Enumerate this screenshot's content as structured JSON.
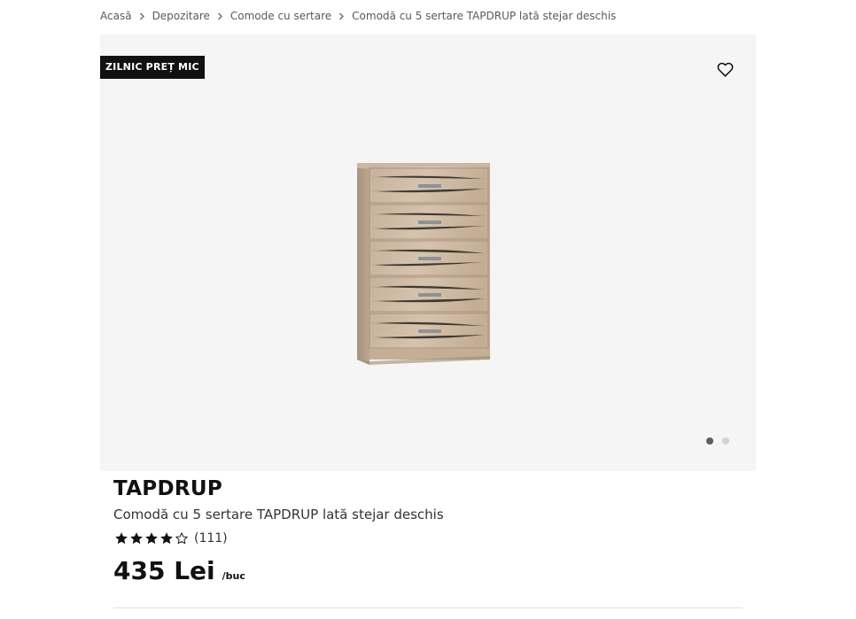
{
  "breadcrumb": {
    "items": [
      "Acasă",
      "Depozitare",
      "Comode cu sertare",
      "Comodă cu 5 sertare TAPDRUP lată stejar deschis"
    ]
  },
  "gallery": {
    "badge": "ZILNIC PREȚ MIC",
    "wishlist_icon": "heart-outline-icon",
    "image_count": 2,
    "active_image": 1
  },
  "product": {
    "brand": "TAPDRUP",
    "name": "Comodă cu 5 sertare TAPDRUP lată stejar deschis",
    "rating": {
      "stars": 4,
      "max_stars": 5,
      "count": "(111)"
    },
    "price": {
      "value": "435 Lei",
      "unit": "/buc"
    }
  },
  "colors": {
    "badge_bg": "#111111",
    "gallery_bg": "#f5f5f5",
    "dot_active": "#5e5e5e",
    "dot_inactive": "#d2d2d2"
  }
}
